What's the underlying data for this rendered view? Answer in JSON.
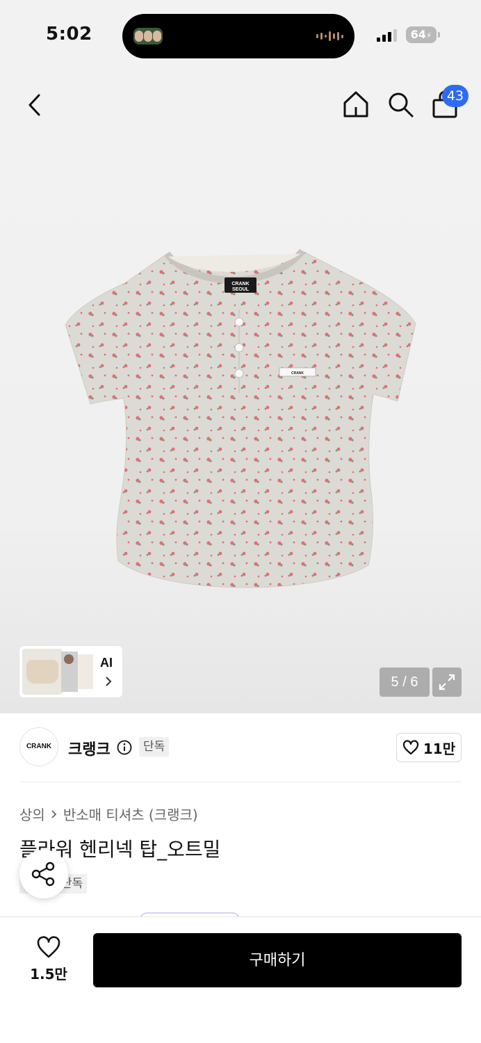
{
  "status_bar": {
    "time": "5:02",
    "battery": "64"
  },
  "header": {
    "icons": [
      "back-icon",
      "home-icon",
      "search-icon",
      "bag-icon"
    ],
    "cart_badge": "43"
  },
  "gallery": {
    "ai_label": "AI",
    "page_indicator": "5 / 6",
    "brand_labels": [
      "CRANK",
      "SEOUL"
    ]
  },
  "brand": {
    "logo_text": "CRANK",
    "name": "크랭크",
    "badge": "단독",
    "likes": "11만"
  },
  "product": {
    "breadcrumb": [
      "상의",
      "반소매 티셔츠 (크랭크)"
    ],
    "title": "플라워 헨리넥 탑_오트밀",
    "tag": "단독"
  },
  "bottom_bar": {
    "wish_count": "1.5만",
    "buy_label": "구매하기"
  },
  "colors": {
    "accent_badge": "#2f6bf0",
    "buy_button": "#000000",
    "shirt": "#dcdad5",
    "flower": "#e46d79"
  }
}
